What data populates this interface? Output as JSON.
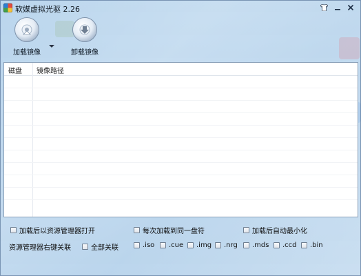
{
  "window": {
    "title": "软媒虚拟光驱 2.26"
  },
  "toolbar": {
    "mount_label": "加载镜像",
    "unmount_label": "卸载镜像"
  },
  "list": {
    "columns": [
      "磁盘",
      "镜像路径"
    ],
    "rows": []
  },
  "options": {
    "open_after_mount": "加载后以资源管理器打开",
    "same_drive_letter": "每次加载到同一盘符",
    "auto_minimize": "加载后自动最小化",
    "context_menu_label": "资源管理器右键关联",
    "associate_all": "全部关联",
    "extensions": [
      ".iso",
      ".cue",
      ".img",
      ".nrg",
      ".mds",
      ".ccd",
      ".bin"
    ]
  }
}
